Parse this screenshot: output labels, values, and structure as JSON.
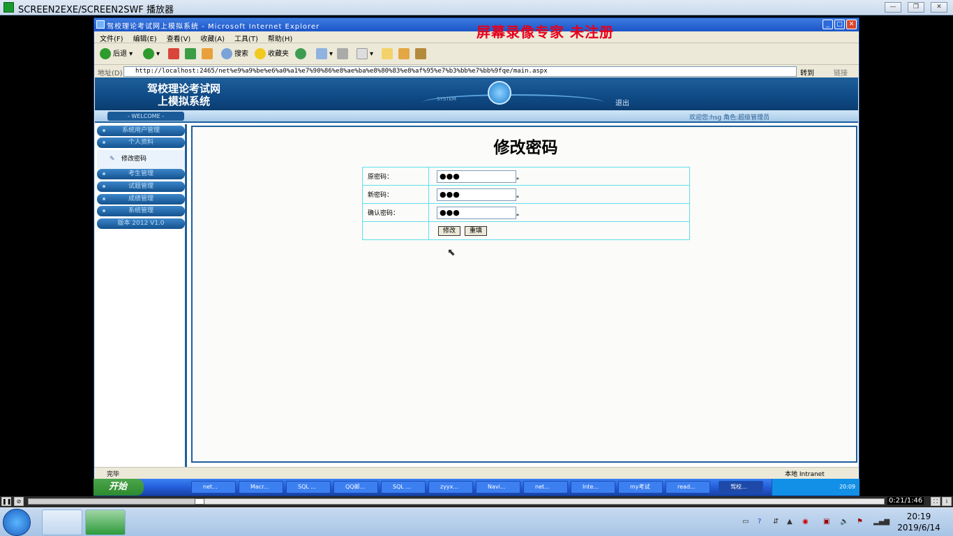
{
  "player": {
    "title": "SCREEN2EXE/SCREEN2SWF 播放器",
    "progress_fraction": 0.2,
    "time": "0:21/1:46"
  },
  "ie": {
    "title": "驾校理论考试网上模拟系统 - Microsoft Internet Explorer",
    "watermark": "屏幕录像专家  未注册",
    "menu": [
      "文件(F)",
      "编辑(E)",
      "查看(V)",
      "收藏(A)",
      "工具(T)",
      "帮助(H)"
    ],
    "toolbar": {
      "back": "后退",
      "search": "搜索",
      "favorites": "收藏夹"
    },
    "address_label": "地址(D)",
    "url": "http://localhost:2465/net%e9%a9%be%e6%a0%a1%e7%90%86%e8%ae%ba%e8%80%83%e8%af%95%e7%b3%bb%e7%bb%9fqe/main.aspx",
    "go": "转到",
    "links": "链接",
    "status_left": "完毕",
    "status_right": "本地 Intranet"
  },
  "page": {
    "banner_title_1": "驾校理论考试网",
    "banner_title_2": "上模拟系统",
    "system_text": "SYSTEM",
    "logout": "退出",
    "welcome": "- WELCOME -",
    "user_info": "欢迎您:hsg 角色:超级管理员",
    "sidebar": [
      "系统用户管理",
      "个人资料",
      "考生管理",
      "试题管理",
      "成绩管理",
      "系统管理",
      "版本 2012 V1.0"
    ],
    "sidebar_sub": "修改密码",
    "form_title": "修改密码",
    "fields": [
      {
        "label": "原密码：",
        "value": "●●●"
      },
      {
        "label": "新密码：",
        "value": "●●●"
      },
      {
        "label": "确认密码：",
        "value": "●●●"
      }
    ],
    "star": "*",
    "submit": "修改",
    "reset": "重填"
  },
  "xp_taskbar": {
    "start": "开始",
    "buttons": [
      "net...",
      "Macr...",
      "SQL ...",
      "QQ邮...",
      "SQL ...",
      "zyyx...",
      "Navi...",
      "net...",
      "Inte...",
      "my考试",
      "read...",
      "驾校..."
    ],
    "clock": "20:09"
  },
  "win7": {
    "time": "20:19",
    "date": "2019/6/14"
  }
}
